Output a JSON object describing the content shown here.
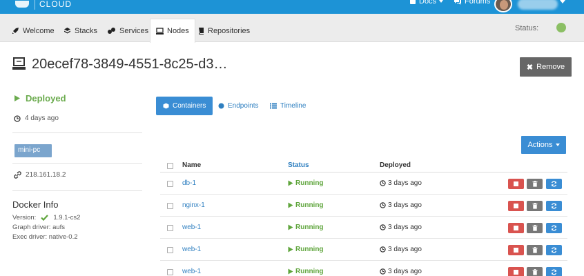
{
  "brand": {
    "logo_text": "CLOUD"
  },
  "topbar": {
    "docs_label": "Docs",
    "forums_label": "Forums"
  },
  "nav": {
    "items": [
      {
        "label": "Welcome",
        "icon": "rocket-icon"
      },
      {
        "label": "Stacks",
        "icon": "stack-icon"
      },
      {
        "label": "Services",
        "icon": "services-icon"
      },
      {
        "label": "Nodes",
        "icon": "server-icon",
        "active": true
      },
      {
        "label": "Repositories",
        "icon": "book-icon"
      }
    ],
    "status_label": "Status:",
    "status_color": "#8bbf64"
  },
  "header": {
    "title": "20ecef78-3849-4551-8c25-d3…",
    "remove_label": "Remove"
  },
  "node": {
    "state": "Deployed",
    "state_color": "#6bab4e",
    "deployed_ago": "4 days ago",
    "tag": "mini-pc",
    "ip": "218.161.18.2"
  },
  "docker_info": {
    "title": "Docker Info",
    "version_label": "Version:",
    "version_value": "1.9.1-cs2",
    "graph_driver": "Graph driver: aufs",
    "exec_driver": "Exec driver: native-0.2"
  },
  "tabs": [
    {
      "label": "Containers",
      "active": true
    },
    {
      "label": "Endpoints"
    },
    {
      "label": "Timeline"
    }
  ],
  "actions_label": "Actions",
  "table": {
    "headers": {
      "name": "Name",
      "status": "Status",
      "deployed": "Deployed"
    },
    "rows": [
      {
        "name": "db-1",
        "status": "Running",
        "deployed": "3 days ago"
      },
      {
        "name": "nginx-1",
        "status": "Running",
        "deployed": "3 days ago"
      },
      {
        "name": "web-1",
        "status": "Running",
        "deployed": "3 days ago"
      },
      {
        "name": "web-1",
        "status": "Running",
        "deployed": "3 days ago"
      },
      {
        "name": "web-1",
        "status": "Running",
        "deployed": "3 days ago"
      }
    ]
  }
}
